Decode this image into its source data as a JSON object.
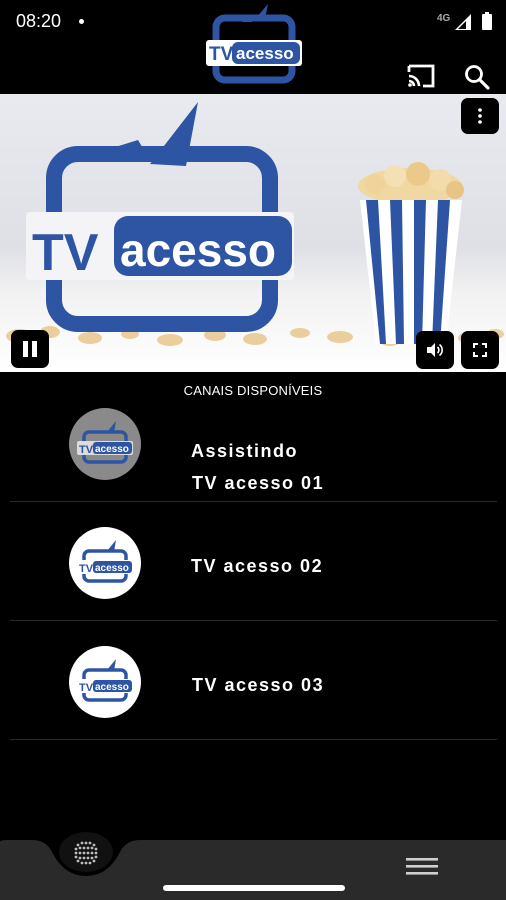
{
  "status": {
    "time": "08:20",
    "network": "4G"
  },
  "logo": {
    "tv": "TV",
    "word": "acesso"
  },
  "list": {
    "header": "CANAIS DISPONÍVEIS",
    "channels": [
      {
        "status": "Assistindo",
        "name": "TV acesso 01",
        "active": true
      },
      {
        "name": "TV acesso 02",
        "active": false
      },
      {
        "name": "TV acesso 03",
        "active": false
      }
    ]
  },
  "colors": {
    "background": "#000000",
    "brand_blue": "#2d55a3",
    "active_thumb": "#8a8a8a"
  },
  "icons": [
    "cast-icon",
    "search-icon",
    "more-vert-icon",
    "pause-icon",
    "volume-icon",
    "fullscreen-icon",
    "grid-dots-icon",
    "hamburger-menu-icon"
  ]
}
